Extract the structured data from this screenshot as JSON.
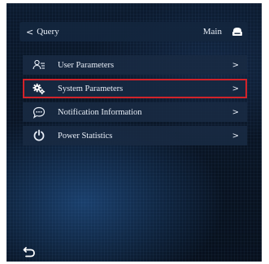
{
  "header": {
    "back_label": "Query",
    "back_icon": "chevron-left-icon",
    "main_label": "Main",
    "main_icon": "home-icon"
  },
  "menu": {
    "items": [
      {
        "label": "User Parameters",
        "icon": "users-icon",
        "selected": false
      },
      {
        "label": "System Parameters",
        "icon": "gears-icon",
        "selected": true
      },
      {
        "label": "Notification Information",
        "icon": "chat-bubble-icon",
        "selected": false
      },
      {
        "label": "Power Statistics",
        "icon": "power-icon",
        "selected": false
      }
    ],
    "chevron": ">"
  },
  "footer": {
    "return_icon": "return-arrow-icon"
  },
  "colors": {
    "selection_border": "#d2232a",
    "text": "#e8eef7",
    "background": "#0a1627"
  }
}
